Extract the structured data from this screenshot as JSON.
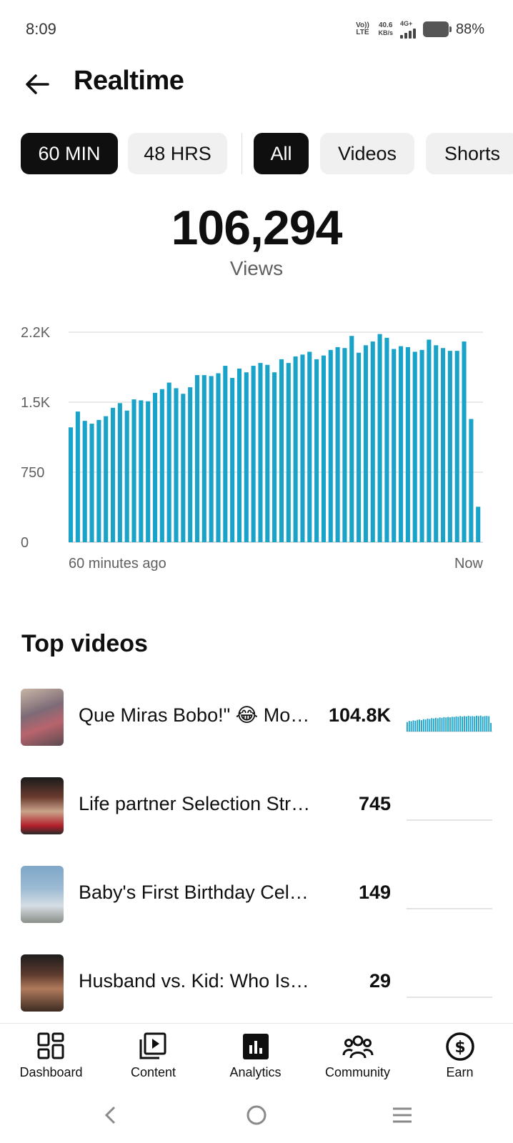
{
  "status_bar": {
    "time": "8:09",
    "volte": "Vo)) LTE",
    "speed_value": "40.6",
    "speed_unit": "KB/s",
    "network": "4G+",
    "battery": "88%"
  },
  "header": {
    "back_icon": "arrow-left-icon",
    "title": "Realtime"
  },
  "filters": {
    "time_ranges": [
      {
        "label": "60 MIN",
        "selected": true
      },
      {
        "label": "48 HRS",
        "selected": false
      }
    ],
    "content_types": [
      {
        "label": "All",
        "selected": true
      },
      {
        "label": "Videos",
        "selected": false
      },
      {
        "label": "Shorts",
        "selected": false
      }
    ]
  },
  "summary": {
    "total": "106,294",
    "label": "Views"
  },
  "chart_data": {
    "type": "bar",
    "color": "#1aa3c9",
    "ylim": [
      0,
      2250
    ],
    "y_ticks": [
      {
        "value": 0,
        "label": "0"
      },
      {
        "value": 750,
        "label": "750"
      },
      {
        "value": 1500,
        "label": "1.5K"
      },
      {
        "value": 2250,
        "label": "2.2K"
      }
    ],
    "x_start_label": "60 minutes ago",
    "x_end_label": "Now",
    "grid": true,
    "values": [
      1230,
      1400,
      1300,
      1270,
      1310,
      1350,
      1440,
      1490,
      1410,
      1530,
      1520,
      1510,
      1600,
      1640,
      1710,
      1650,
      1590,
      1660,
      1790,
      1790,
      1780,
      1810,
      1890,
      1760,
      1860,
      1820,
      1890,
      1920,
      1900,
      1820,
      1960,
      1920,
      1990,
      2010,
      2040,
      1960,
      2000,
      2060,
      2090,
      2080,
      2210,
      2030,
      2110,
      2150,
      2230,
      2190,
      2070,
      2100,
      2090,
      2040,
      2060,
      2170,
      2110,
      2080,
      2050,
      2050,
      2150,
      1320,
      380
    ]
  },
  "top_videos": {
    "title": "Top videos",
    "items": [
      {
        "title": "Que Miras Bobo!\" 😂 Mom's Reaction",
        "views": "104.8K",
        "spark": [
          0.55,
          0.62,
          0.6,
          0.65,
          0.63,
          0.68,
          0.7,
          0.66,
          0.72,
          0.7,
          0.75,
          0.73,
          0.78,
          0.76,
          0.8,
          0.77,
          0.82,
          0.8,
          0.84,
          0.82,
          0.85,
          0.83,
          0.86,
          0.85,
          0.88,
          0.86,
          0.9,
          0.87,
          0.9,
          0.88,
          0.92,
          0.89,
          0.9,
          0.88,
          0.92,
          0.9,
          0.93,
          0.88,
          0.9,
          0.91,
          0.89,
          0.5
        ]
      },
      {
        "title": "Life partner Selection Struggle",
        "views": "745",
        "spark": []
      },
      {
        "title": "Baby's First Birthday Celebration",
        "views": "149",
        "spark": []
      },
      {
        "title": "Husband vs. Kid: Who Is Better",
        "views": "29",
        "spark": []
      }
    ]
  },
  "bottom_nav": [
    {
      "label": "Dashboard",
      "icon": "dashboard-icon",
      "active": false
    },
    {
      "label": "Content",
      "icon": "content-icon",
      "active": false
    },
    {
      "label": "Analytics",
      "icon": "analytics-icon",
      "active": true
    },
    {
      "label": "Community",
      "icon": "community-icon",
      "active": false
    },
    {
      "label": "Earn",
      "icon": "earn-icon",
      "active": false
    }
  ],
  "system_nav": [
    "back-icon",
    "home-icon",
    "menu-icon"
  ]
}
